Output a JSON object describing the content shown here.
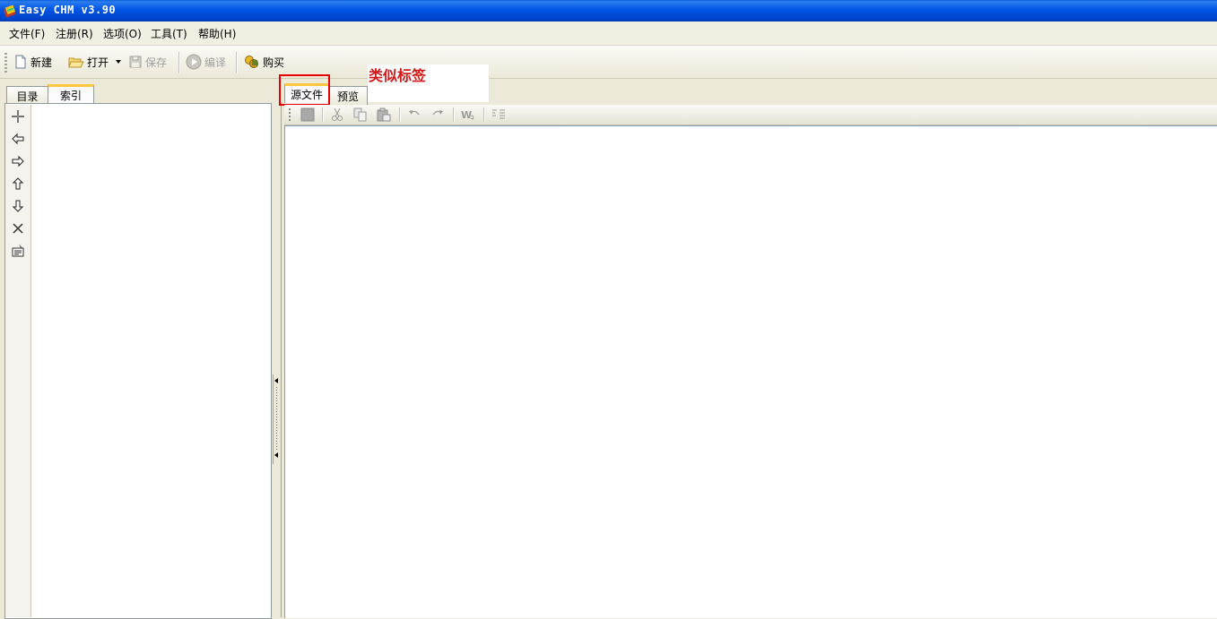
{
  "window": {
    "title": "Easy CHM v3.90"
  },
  "menu": [
    {
      "label": "文件(F)"
    },
    {
      "label": "注册(R)"
    },
    {
      "label": "选项(O)"
    },
    {
      "label": "工具(T)"
    },
    {
      "label": "帮助(H)"
    }
  ],
  "toolbar": {
    "new_label": "新建",
    "open_label": "打开",
    "save_label": "保存",
    "compile_label": "编译",
    "buy_label": "购买"
  },
  "left_panel": {
    "tabs": [
      {
        "label": "目录"
      },
      {
        "label": "索引"
      }
    ],
    "active_tab": "索引",
    "tools": [
      "add-icon",
      "arrow-left-icon",
      "arrow-right-icon",
      "arrow-up-icon",
      "arrow-down-icon",
      "delete-icon",
      "properties-icon"
    ]
  },
  "right_panel": {
    "tabs": [
      {
        "label": "源文件"
      },
      {
        "label": "预览"
      }
    ],
    "active_tab": "源文件",
    "annotation": "类似标签",
    "editor_tools": [
      "stop-icon",
      "cut-icon",
      "copy-icon",
      "paste-icon",
      "undo-icon",
      "redo-icon",
      "word-wrap-icon",
      "line-number-icon"
    ]
  },
  "colors": {
    "annotation": "#d31818",
    "highlight_box": "#e60000",
    "titlebar": "#0055e5"
  }
}
